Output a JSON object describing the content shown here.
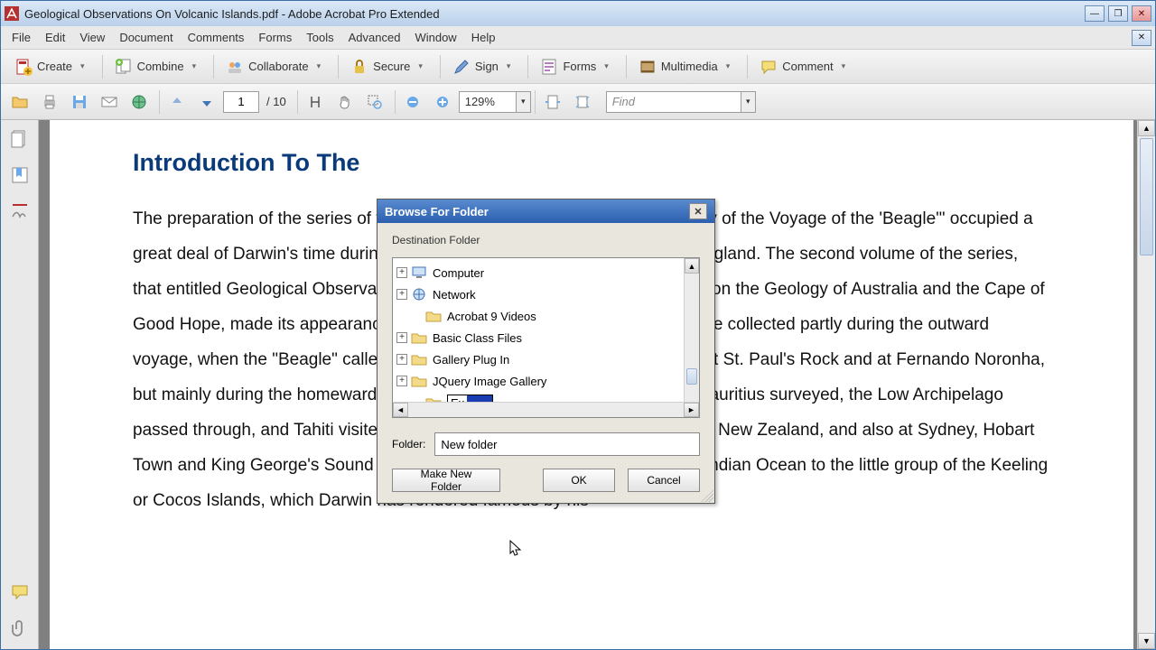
{
  "app": {
    "title": "Geological Observations On Volcanic Islands.pdf - Adobe Acrobat Pro Extended",
    "app_icon_color": "#b73030"
  },
  "menu": {
    "items": [
      "File",
      "Edit",
      "View",
      "Document",
      "Comments",
      "Forms",
      "Tools",
      "Advanced",
      "Window",
      "Help"
    ]
  },
  "toolbar1": {
    "create": "Create",
    "combine": "Combine",
    "collaborate": "Collaborate",
    "secure": "Secure",
    "sign": "Sign",
    "forms": "Forms",
    "multimedia": "Multimedia",
    "comment": "Comment"
  },
  "toolbar2": {
    "page_current": "1",
    "page_total_prefix": "/",
    "page_total": "10",
    "zoom": "129%",
    "find_placeholder": "Find"
  },
  "document": {
    "heading": "Introduction To The",
    "body": "The preparation of the series of volumes that go by the general title \"Geology of the Voyage of the 'Beagle'\" occupied a great deal of Darwin's time during the ten years that followed his return to England. The second volume of the series, that entitled Geological Observations on Volcanic Islands, with Brief Notices on the Geology of Australia and the Cape of Good Hope, made its appearance in 1844. The materials for this volume were collected partly during the outward voyage, when the \"Beagle\" called at St. Jago in the Cape de Verde Islands at St. Paul's Rock and at Fernando Noronha, but mainly during the homeward cruise; the Galapagos Islands, Tahiti and Mauritius surveyed, the Low Archipelago passed through, and Tahiti visited; after making calls at the Bay of Islands, in New Zealand, and also at Sydney, Hobart Town and King George's Sound in Australia, the \"Beagle\" sailed across the Indian Ocean to the little group of the Keeling or Cocos Islands, which Darwin has rendered famous by his"
  },
  "dialog": {
    "title": "Browse For Folder",
    "destination_label": "Destination Folder",
    "tree": {
      "items": [
        {
          "label": "Computer",
          "expandable": true,
          "icon": "computer"
        },
        {
          "label": "Network",
          "expandable": true,
          "icon": "network"
        },
        {
          "label": "Acrobat 9 Videos",
          "expandable": false,
          "icon": "folder"
        },
        {
          "label": "Basic Class Files",
          "expandable": true,
          "icon": "folder"
        },
        {
          "label": "Gallery Plug In",
          "expandable": true,
          "icon": "folder"
        },
        {
          "label": "JQuery Image Gallery",
          "expandable": true,
          "icon": "folder"
        }
      ],
      "editing_folder_typed": "Ex"
    },
    "folder_label": "Folder:",
    "folder_value": "New folder",
    "make_new_folder": "Make New Folder",
    "ok": "OK",
    "cancel": "Cancel"
  }
}
